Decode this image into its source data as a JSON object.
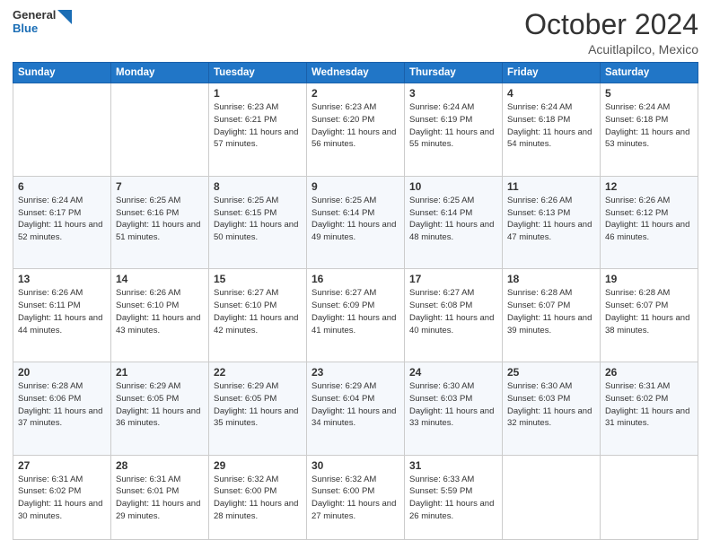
{
  "header": {
    "logo_line1": "General",
    "logo_line2": "Blue",
    "month": "October 2024",
    "location": "Acuitlapilco, Mexico"
  },
  "days_of_week": [
    "Sunday",
    "Monday",
    "Tuesday",
    "Wednesday",
    "Thursday",
    "Friday",
    "Saturday"
  ],
  "weeks": [
    [
      {
        "day": "",
        "info": ""
      },
      {
        "day": "",
        "info": ""
      },
      {
        "day": "1",
        "info": "Sunrise: 6:23 AM\nSunset: 6:21 PM\nDaylight: 11 hours and 57 minutes."
      },
      {
        "day": "2",
        "info": "Sunrise: 6:23 AM\nSunset: 6:20 PM\nDaylight: 11 hours and 56 minutes."
      },
      {
        "day": "3",
        "info": "Sunrise: 6:24 AM\nSunset: 6:19 PM\nDaylight: 11 hours and 55 minutes."
      },
      {
        "day": "4",
        "info": "Sunrise: 6:24 AM\nSunset: 6:18 PM\nDaylight: 11 hours and 54 minutes."
      },
      {
        "day": "5",
        "info": "Sunrise: 6:24 AM\nSunset: 6:18 PM\nDaylight: 11 hours and 53 minutes."
      }
    ],
    [
      {
        "day": "6",
        "info": "Sunrise: 6:24 AM\nSunset: 6:17 PM\nDaylight: 11 hours and 52 minutes."
      },
      {
        "day": "7",
        "info": "Sunrise: 6:25 AM\nSunset: 6:16 PM\nDaylight: 11 hours and 51 minutes."
      },
      {
        "day": "8",
        "info": "Sunrise: 6:25 AM\nSunset: 6:15 PM\nDaylight: 11 hours and 50 minutes."
      },
      {
        "day": "9",
        "info": "Sunrise: 6:25 AM\nSunset: 6:14 PM\nDaylight: 11 hours and 49 minutes."
      },
      {
        "day": "10",
        "info": "Sunrise: 6:25 AM\nSunset: 6:14 PM\nDaylight: 11 hours and 48 minutes."
      },
      {
        "day": "11",
        "info": "Sunrise: 6:26 AM\nSunset: 6:13 PM\nDaylight: 11 hours and 47 minutes."
      },
      {
        "day": "12",
        "info": "Sunrise: 6:26 AM\nSunset: 6:12 PM\nDaylight: 11 hours and 46 minutes."
      }
    ],
    [
      {
        "day": "13",
        "info": "Sunrise: 6:26 AM\nSunset: 6:11 PM\nDaylight: 11 hours and 44 minutes."
      },
      {
        "day": "14",
        "info": "Sunrise: 6:26 AM\nSunset: 6:10 PM\nDaylight: 11 hours and 43 minutes."
      },
      {
        "day": "15",
        "info": "Sunrise: 6:27 AM\nSunset: 6:10 PM\nDaylight: 11 hours and 42 minutes."
      },
      {
        "day": "16",
        "info": "Sunrise: 6:27 AM\nSunset: 6:09 PM\nDaylight: 11 hours and 41 minutes."
      },
      {
        "day": "17",
        "info": "Sunrise: 6:27 AM\nSunset: 6:08 PM\nDaylight: 11 hours and 40 minutes."
      },
      {
        "day": "18",
        "info": "Sunrise: 6:28 AM\nSunset: 6:07 PM\nDaylight: 11 hours and 39 minutes."
      },
      {
        "day": "19",
        "info": "Sunrise: 6:28 AM\nSunset: 6:07 PM\nDaylight: 11 hours and 38 minutes."
      }
    ],
    [
      {
        "day": "20",
        "info": "Sunrise: 6:28 AM\nSunset: 6:06 PM\nDaylight: 11 hours and 37 minutes."
      },
      {
        "day": "21",
        "info": "Sunrise: 6:29 AM\nSunset: 6:05 PM\nDaylight: 11 hours and 36 minutes."
      },
      {
        "day": "22",
        "info": "Sunrise: 6:29 AM\nSunset: 6:05 PM\nDaylight: 11 hours and 35 minutes."
      },
      {
        "day": "23",
        "info": "Sunrise: 6:29 AM\nSunset: 6:04 PM\nDaylight: 11 hours and 34 minutes."
      },
      {
        "day": "24",
        "info": "Sunrise: 6:30 AM\nSunset: 6:03 PM\nDaylight: 11 hours and 33 minutes."
      },
      {
        "day": "25",
        "info": "Sunrise: 6:30 AM\nSunset: 6:03 PM\nDaylight: 11 hours and 32 minutes."
      },
      {
        "day": "26",
        "info": "Sunrise: 6:31 AM\nSunset: 6:02 PM\nDaylight: 11 hours and 31 minutes."
      }
    ],
    [
      {
        "day": "27",
        "info": "Sunrise: 6:31 AM\nSunset: 6:02 PM\nDaylight: 11 hours and 30 minutes."
      },
      {
        "day": "28",
        "info": "Sunrise: 6:31 AM\nSunset: 6:01 PM\nDaylight: 11 hours and 29 minutes."
      },
      {
        "day": "29",
        "info": "Sunrise: 6:32 AM\nSunset: 6:00 PM\nDaylight: 11 hours and 28 minutes."
      },
      {
        "day": "30",
        "info": "Sunrise: 6:32 AM\nSunset: 6:00 PM\nDaylight: 11 hours and 27 minutes."
      },
      {
        "day": "31",
        "info": "Sunrise: 6:33 AM\nSunset: 5:59 PM\nDaylight: 11 hours and 26 minutes."
      },
      {
        "day": "",
        "info": ""
      },
      {
        "day": "",
        "info": ""
      }
    ]
  ]
}
